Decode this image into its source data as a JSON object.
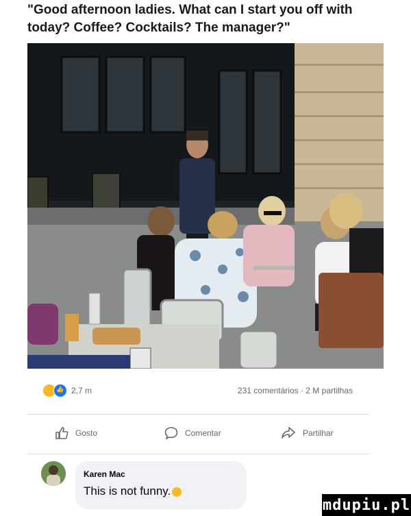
{
  "meme": {
    "caption": "\"Good afternoon ladies. What can I start you off with today? Coffee? Cocktails? The manager?\""
  },
  "post": {
    "reactions": {
      "icons": [
        "haha-emoji-icon",
        "like-icon"
      ],
      "count": "2,7 m"
    },
    "stats_text": "231 comentários · 2 M partilhas"
  },
  "actions": {
    "like_label": "Gosto",
    "comment_label": "Comentar",
    "share_label": "Partilhar"
  },
  "comment": {
    "author": "Karen Mac",
    "text": "This is not funny."
  },
  "watermark": {
    "text": "mdupiu.pl"
  },
  "colors": {
    "like_blue": "#1877f2",
    "haha_yellow": "#f7b928",
    "meta_gray": "#65676b",
    "bubble_bg": "#f0f2f5"
  }
}
